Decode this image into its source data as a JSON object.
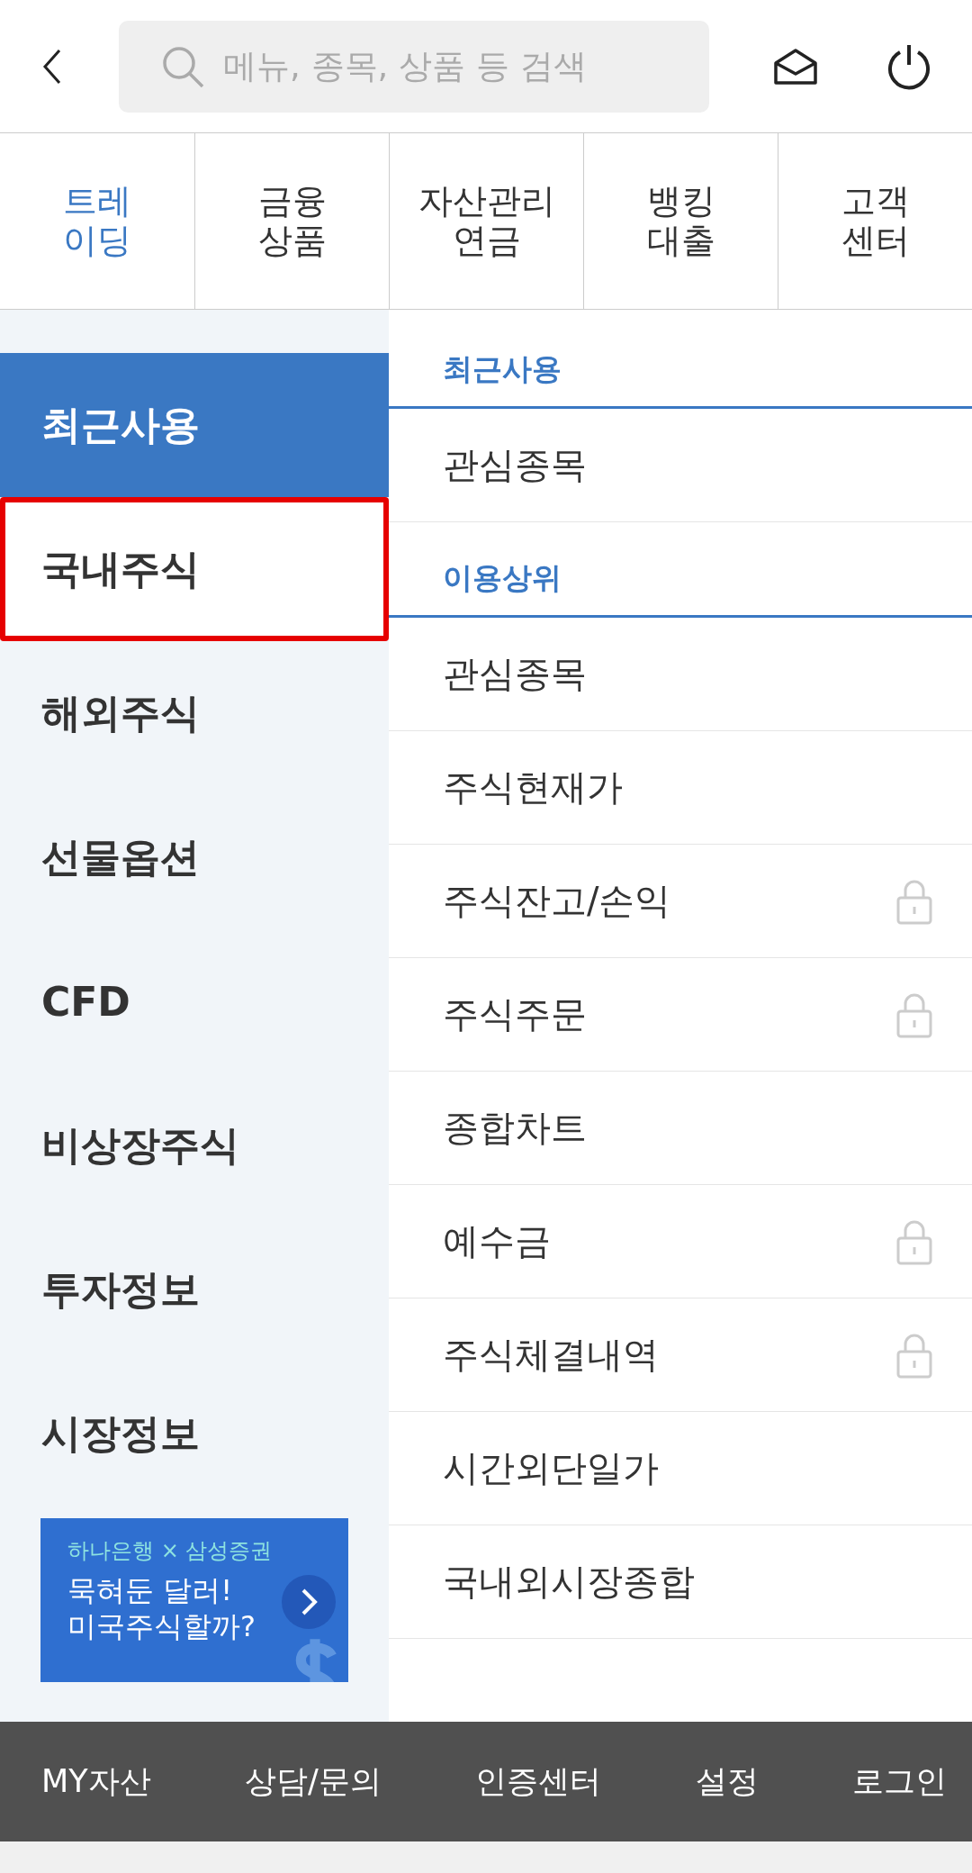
{
  "search": {
    "placeholder": "메뉴, 종목, 상품 등 검색"
  },
  "tabs": [
    {
      "label": "트레\n이딩",
      "selected": true
    },
    {
      "label": "금융\n상품",
      "selected": false
    },
    {
      "label": "자산관리\n연금",
      "selected": false
    },
    {
      "label": "뱅킹\n대출",
      "selected": false
    },
    {
      "label": "고객\n센터",
      "selected": false
    }
  ],
  "sidebar": {
    "items": [
      {
        "label": "최근사용",
        "selected": true,
        "highlighted": false
      },
      {
        "label": "국내주식",
        "selected": false,
        "highlighted": true
      },
      {
        "label": "해외주식",
        "selected": false,
        "highlighted": false
      },
      {
        "label": "선물옵션",
        "selected": false,
        "highlighted": false
      },
      {
        "label": "CFD",
        "selected": false,
        "highlighted": false
      },
      {
        "label": "비상장주식",
        "selected": false,
        "highlighted": false
      },
      {
        "label": "투자정보",
        "selected": false,
        "highlighted": false
      },
      {
        "label": "시장정보",
        "selected": false,
        "highlighted": false
      }
    ],
    "banner": {
      "brand": "하나은행 × 삼성증권",
      "headline": "묵혀둔 달러!\n미국주식할까?"
    }
  },
  "sections": [
    {
      "title": "최근사용",
      "rows": [
        {
          "label": "관심종목",
          "locked": false
        }
      ]
    },
    {
      "title": "이용상위",
      "rows": [
        {
          "label": "관심종목",
          "locked": false
        },
        {
          "label": "주식현재가",
          "locked": false
        },
        {
          "label": "주식잔고/손익",
          "locked": true
        },
        {
          "label": "주식주문",
          "locked": true
        },
        {
          "label": "종합차트",
          "locked": false
        },
        {
          "label": "예수금",
          "locked": true
        },
        {
          "label": "주식체결내역",
          "locked": true
        },
        {
          "label": "시간외단일가",
          "locked": false
        },
        {
          "label": "국내외시장종합",
          "locked": false
        }
      ]
    }
  ],
  "bottom_bar": [
    "MY자산",
    "상담/문의",
    "인증센터",
    "설정",
    "로그인"
  ]
}
